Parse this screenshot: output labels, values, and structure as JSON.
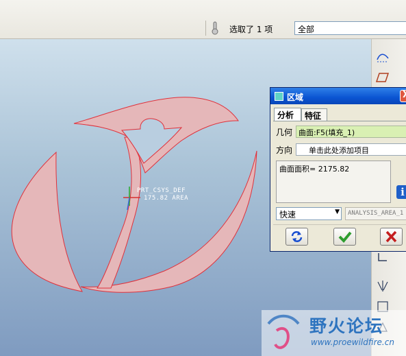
{
  "statusbar": {
    "selection_text": "选取了 1 项",
    "filter_value": "全部",
    "status_icon": "thermometer-icon"
  },
  "viewport": {
    "csys_label": "PRT_CSYS_DEF",
    "area_label": "175.82 AREA",
    "model_fill": "#e5b7b9",
    "model_edge": "#e0303a"
  },
  "dialog": {
    "title": "区域",
    "tabs": [
      {
        "label": "分析",
        "active": true
      },
      {
        "label": "特征",
        "active": false
      }
    ],
    "geometry_label": "几何",
    "geometry_value": "曲面:F5(填充_1)",
    "direction_label": "方向",
    "direction_value": "单击此处添加项目",
    "result": "曲面面积= 2175.82",
    "mode_value": "快速",
    "analysis_name": "ANALYSIS_AREA_1",
    "close_label": "X"
  },
  "watermark": {
    "title": "野火论坛",
    "url": "www.proewildfire.cn"
  },
  "colors": {
    "accent": "#0a54d2",
    "ok_green": "#2e9d2e",
    "cancel_red": "#c41e1e"
  }
}
